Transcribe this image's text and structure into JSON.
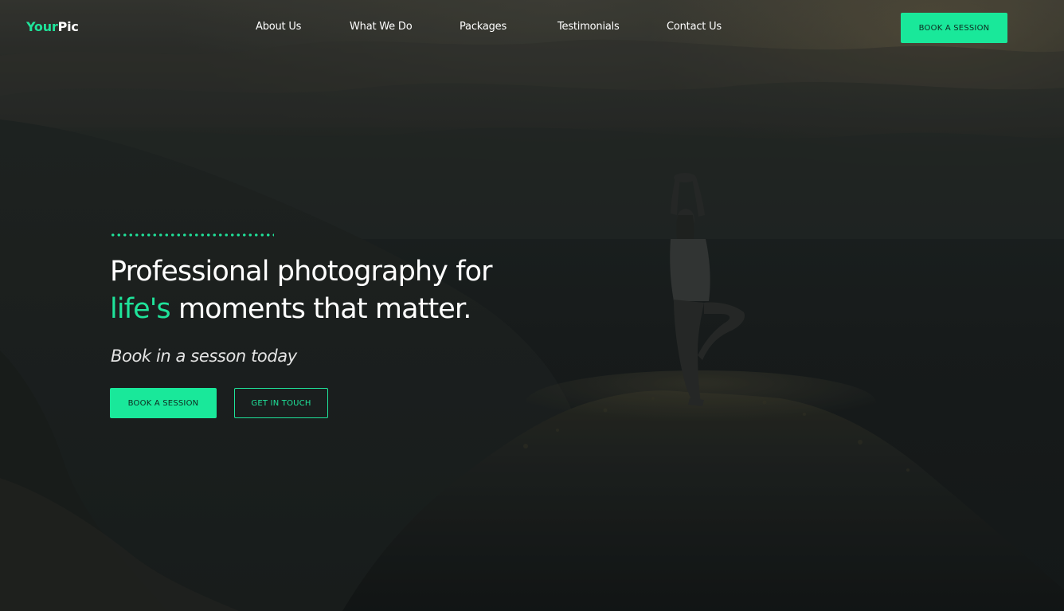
{
  "brand": {
    "name_part1": "Your",
    "name_part2": "Pic"
  },
  "nav": {
    "items": [
      {
        "label": "About Us"
      },
      {
        "label": "What We Do"
      },
      {
        "label": "Packages"
      },
      {
        "label": "Testimonials"
      },
      {
        "label": "Contact Us"
      }
    ]
  },
  "header": {
    "cta_label": "BOOK A SESSION"
  },
  "hero": {
    "headline_line1": "Professional photography for",
    "headline_accent": "life's",
    "headline_rest": " moments that matter.",
    "subheadline": "Book in a sesson today",
    "primary_button": "BOOK A SESSION",
    "secondary_button": "GET IN TOUCH",
    "background_image": "silhouette-yoga-mountain-image"
  },
  "colors": {
    "accent": "#1fe39a",
    "button_fill": "#19e89a",
    "text": "#ffffff",
    "background": "#171a1a"
  }
}
